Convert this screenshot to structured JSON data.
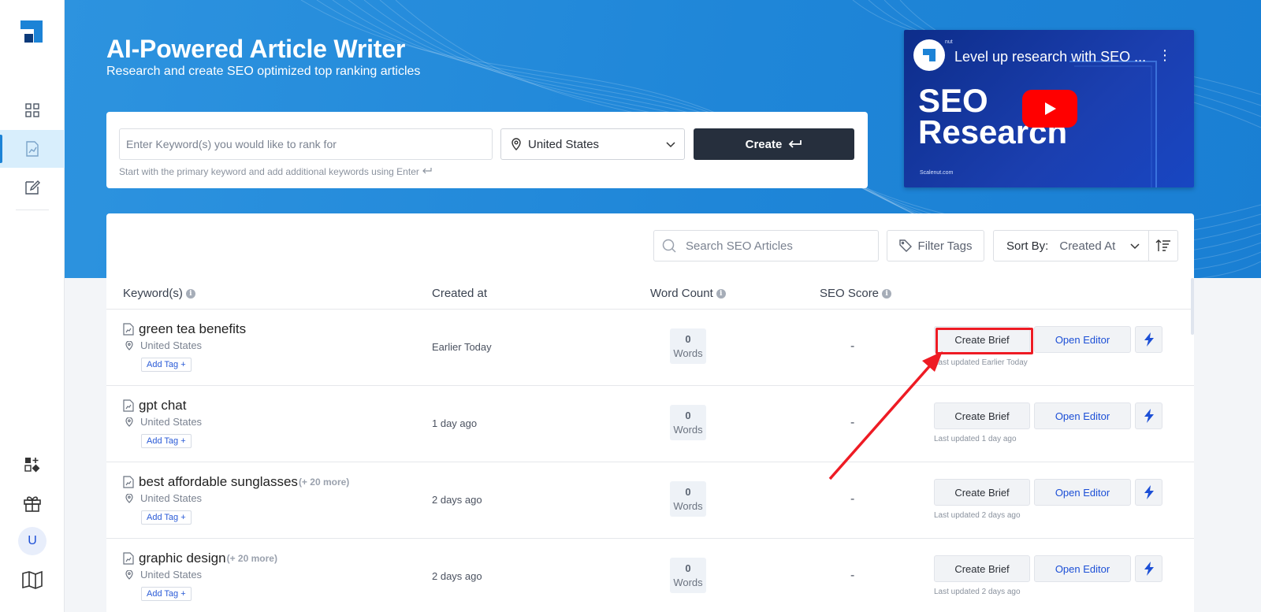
{
  "sidebar": {
    "items": [
      {
        "name": "dashboard",
        "icon": "grid-icon"
      },
      {
        "name": "seo-articles",
        "icon": "document-chart-icon",
        "active": true
      },
      {
        "name": "editor",
        "icon": "edit-note-icon"
      }
    ],
    "bottom": {
      "avatar_initial": "U"
    }
  },
  "hero": {
    "title": "AI-Powered Article Writer",
    "subtitle": "Research and create SEO optimized top ranking articles",
    "create_card": {
      "keyword_placeholder": "Enter Keyword(s) you would like to rank for",
      "country": "United States",
      "create_label": "Create",
      "hint": "Start with the primary keyword and add additional keywords using Enter"
    },
    "video": {
      "title": "Level up research with SEO ...",
      "big_line1": "SEO",
      "big_line2": "Research",
      "small_text": "Scalenut.com",
      "top_text": "nut"
    }
  },
  "toolbar": {
    "search_placeholder": "Search SEO Articles",
    "filter_label": "Filter Tags",
    "sort_label": "Sort By:",
    "sort_value": "Created At"
  },
  "table": {
    "headers": {
      "keywords": "Keyword(s)",
      "created": "Created at",
      "word_count": "Word Count",
      "seo_score": "SEO Score"
    },
    "rows": [
      {
        "keyword": "green tea benefits",
        "more": "",
        "location": "United States",
        "tag": "Add Tag +",
        "created": "Earlier Today",
        "words_num": "0",
        "words_label": "Words",
        "seo": "-",
        "brief": "Create Brief",
        "editor": "Open Editor",
        "updated": "Last updated Earlier Today"
      },
      {
        "keyword": "gpt chat",
        "more": "",
        "location": "United States",
        "tag": "Add Tag +",
        "created": "1 day ago",
        "words_num": "0",
        "words_label": "Words",
        "seo": "-",
        "brief": "Create Brief",
        "editor": "Open Editor",
        "updated": "Last updated 1 day ago"
      },
      {
        "keyword": "best affordable sunglasses",
        "more": "(+ 20 more)",
        "location": "United States",
        "tag": "Add Tag +",
        "created": "2 days ago",
        "words_num": "0",
        "words_label": "Words",
        "seo": "-",
        "brief": "Create Brief",
        "editor": "Open Editor",
        "updated": "Last updated 2 days ago"
      },
      {
        "keyword": "graphic design",
        "more": "(+ 20 more)",
        "location": "United States",
        "tag": "Add Tag +",
        "created": "2 days ago",
        "words_num": "0",
        "words_label": "Words",
        "seo": "-",
        "brief": "Create Brief",
        "editor": "Open Editor",
        "updated": "Last updated 2 days ago"
      }
    ]
  },
  "colors": {
    "brand_blue": "#1c83d6",
    "dark_button": "#262f3d",
    "annotation_red": "#ee1b24",
    "link_blue": "#1c4fd6"
  }
}
